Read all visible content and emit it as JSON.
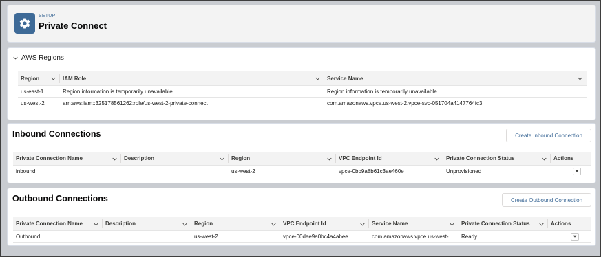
{
  "header": {
    "kicker": "SETUP",
    "title": "Private Connect",
    "icon": "gear-icon"
  },
  "aws": {
    "title": "AWS Regions",
    "columns": [
      "Region",
      "IAM Role",
      "Service Name"
    ],
    "rows": [
      [
        "us-east-1",
        "Region information is temporarily unavailable",
        "Region information is temporarily unavailable"
      ],
      [
        "us-west-2",
        "arn:aws:iam::325178561262:role/us-west-2-private-connect",
        "com.amazonaws.vpce.us-west-2.vpce-svc-051704a4147764fc3"
      ]
    ]
  },
  "inbound": {
    "title": "Inbound Connections",
    "button": "Create Inbound Connection",
    "columns": [
      "Private Connection Name",
      "Description",
      "Region",
      "VPC Endpoint Id",
      "Private Connection Status",
      "Actions"
    ],
    "rows": [
      [
        "inbound",
        "",
        "us-west-2",
        "vpce-0bb9a8b61c3ae460e",
        "Unprovisioned"
      ]
    ]
  },
  "outbound": {
    "title": "Outbound Connections",
    "button": "Create Outbound Connection",
    "columns": [
      "Private Connection Name",
      "Description",
      "Region",
      "VPC Endpoint Id",
      "Service Name",
      "Private Connection Status",
      "Actions"
    ],
    "rows": [
      [
        "Outbound",
        "",
        "us-west-2",
        "vpce-00dee9a0bc4a4abee",
        "com.amazonaws.vpce.us-west-...",
        "Ready"
      ]
    ]
  },
  "colors": {
    "brand": "#3e6a97",
    "header_bg": "#f3f3f3",
    "page_bg": "#c9ccd1"
  }
}
